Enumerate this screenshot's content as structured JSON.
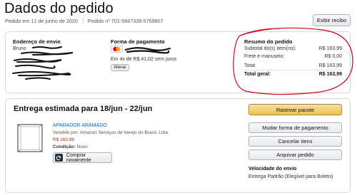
{
  "page": {
    "title": "Dados do pedido",
    "order_date": "Pedido em 12 de junho de 2020",
    "order_number": "Pedido nº 701-5667339-5769807",
    "receipt_button": "Exibir recibo"
  },
  "shipping_address": {
    "title": "Endereço de envio",
    "name_line": "Bruno"
  },
  "payment": {
    "title": "Forma de pagamento",
    "installments": "Em 4x de R$ 41,02 sem juros",
    "change_button": "Alterar"
  },
  "summary": {
    "title": "Resumo do pedido",
    "rows": [
      {
        "label": "Subtotal do(s) item(ns):",
        "value": "R$ 163,99"
      },
      {
        "label": "Frete e manuseio:",
        "value": "R$ 0,00"
      },
      {
        "label": "Total:",
        "value": "R$ 163,99"
      }
    ],
    "grand_total": {
      "label": "Total geral:",
      "value": "R$ 163,99"
    }
  },
  "shipment": {
    "title": "Entrega estimada para 18/jun - 22/jun",
    "product": {
      "name": "APARADOR ARAMADO",
      "seller": "Vendido por: Amazon Serviços de Varejo do Brasil, Ltda.",
      "price": "R$ 163,99",
      "condition_label": "Condição:",
      "condition_value": "Novo",
      "buy_again": "Comprar novamente"
    },
    "actions": {
      "track": "Rastrear pacote",
      "change_payment": "Mudar forma de pagamento",
      "cancel": "Cancelar itens",
      "archive": "Arquivar pedido"
    },
    "speed": {
      "title": "Velocidade do envio",
      "value": "Entrega Padrão (Elegível para Boleto)"
    }
  },
  "colors": {
    "primary_button": "#f0c14b",
    "link": "#0066c0",
    "price": "#b12704",
    "annotation": "#d0021b"
  }
}
